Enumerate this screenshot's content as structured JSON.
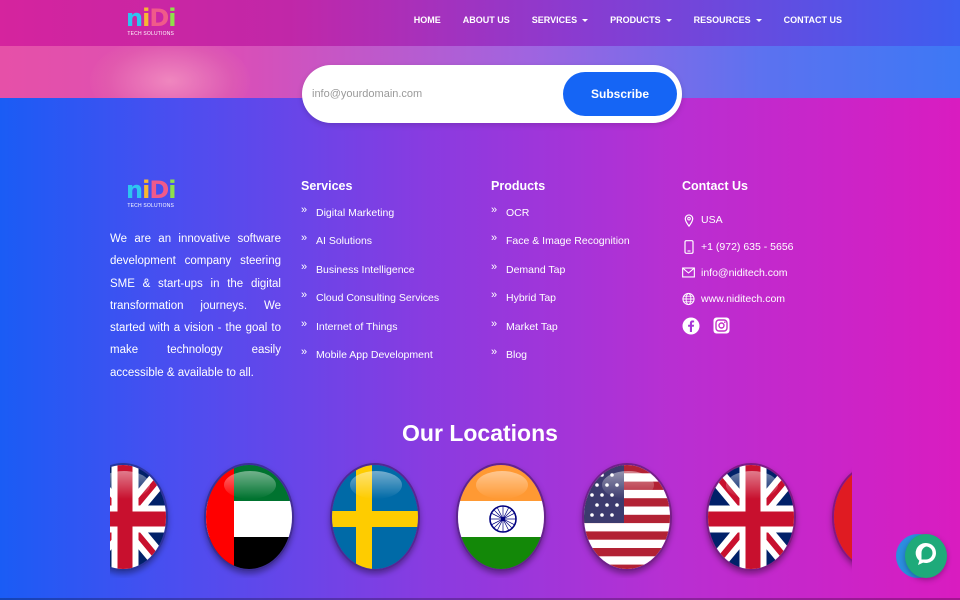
{
  "colors": {
    "brand_n": "#2ec5f0",
    "brand_i1": "#f7b733",
    "brand_d": "#f05a8a",
    "brand_i2": "#8ee04a",
    "subscribe_button": "#1565f5",
    "chat_button": "#1eaa7a"
  },
  "header": {
    "logo": {
      "letters": [
        "n",
        "i",
        "D",
        "i"
      ],
      "tagline": "TECH SOLUTIONS"
    },
    "nav": [
      {
        "label": "HOME",
        "dropdown": false
      },
      {
        "label": "ABOUT US",
        "dropdown": false
      },
      {
        "label": "SERVICES",
        "dropdown": true
      },
      {
        "label": "PRODUCTS",
        "dropdown": true
      },
      {
        "label": "RESOURCES",
        "dropdown": true
      },
      {
        "label": "CONTACT US",
        "dropdown": false
      }
    ]
  },
  "subscribe": {
    "placeholder": "info@yourdomain.com",
    "button_label": "Subscribe"
  },
  "footer": {
    "logo": {
      "letters": [
        "n",
        "i",
        "D",
        "i"
      ],
      "tagline": "TECH SOLUTIONS"
    },
    "about": "We are an innovative software development company steering SME & start-ups in the digital transformation journeys. We started with a vision - the goal to make technology easily accessible & available to all.",
    "services": {
      "title": "Services",
      "items": [
        "Digital Marketing",
        "AI Solutions",
        "Business Intelligence",
        "Cloud Consulting Services",
        "Internet of Things",
        "Mobile App Development"
      ]
    },
    "products": {
      "title": "Products",
      "items": [
        "OCR",
        "Face & Image Recognition",
        "Demand Tap",
        "Hybrid Tap",
        "Market Tap",
        "Blog"
      ]
    },
    "contact": {
      "title": "Contact Us",
      "location": "USA",
      "phone": "+1 (972) 635 - 5656",
      "email": "info@niditech.com",
      "website": "www.niditech.com",
      "social": [
        "facebook-icon",
        "instagram-icon"
      ]
    }
  },
  "locations": {
    "title": "Our Locations",
    "flags": [
      "uk",
      "uae",
      "sweden",
      "india",
      "usa",
      "uk",
      "partial"
    ]
  }
}
